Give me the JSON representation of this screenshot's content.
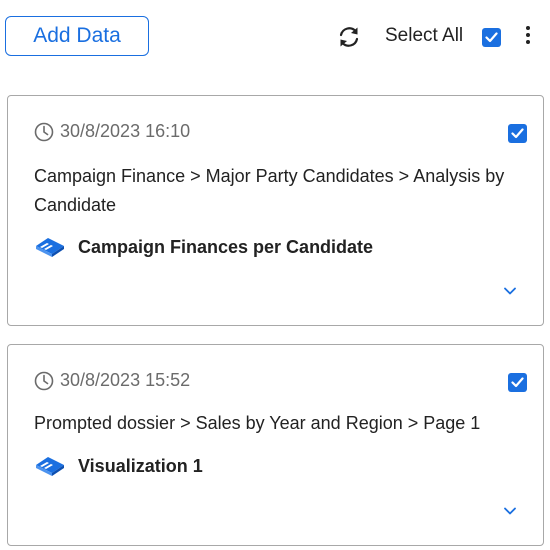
{
  "toolbar": {
    "add_data_label": "Add Data",
    "select_all_label": "Select All",
    "select_all_checked": true,
    "refresh_icon": "refresh-icon",
    "more_icon": "more-vertical-icon"
  },
  "colors": {
    "accent": "#1a6fe0",
    "timestamp_text": "#6b6b6b",
    "card_border": "#a8a8a8"
  },
  "cards": [
    {
      "timestamp": "30/8/2023 16:10",
      "checked": true,
      "path": "Campaign Finance > Major Party Candidates > Analysis by Candidate",
      "item_name": "Campaign Finances per Candidate",
      "item_icon": "dossier-icon"
    },
    {
      "timestamp": "30/8/2023 15:52",
      "checked": true,
      "path": "Prompted dossier > Sales by Year and Region > Page 1",
      "item_name": "Visualization 1",
      "item_icon": "dossier-icon"
    }
  ]
}
